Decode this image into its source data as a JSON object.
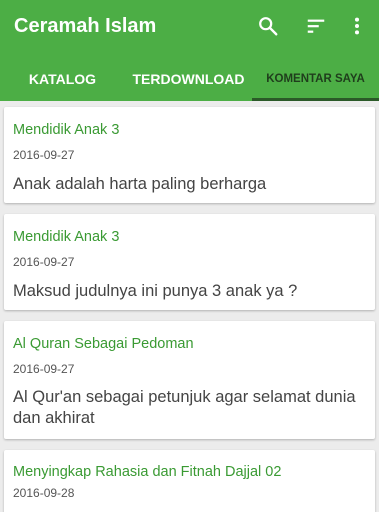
{
  "appbar": {
    "title": "Ceramah Islam",
    "accent_color": "#4cae45",
    "icons": [
      "search-icon",
      "sort-icon",
      "more-vert-icon"
    ]
  },
  "tabs": [
    {
      "label": "KATALOG",
      "selected": false
    },
    {
      "label": "TERDOWNLOAD",
      "selected": false
    },
    {
      "label": "KOMENTAR SAYA",
      "selected": true
    }
  ],
  "comments": [
    {
      "title": "Mendidik Anak 3",
      "date": "2016-09-27",
      "text": "Anak adalah harta paling berharga"
    },
    {
      "title": "Mendidik Anak 3",
      "date": "2016-09-27",
      "text": "Maksud judulnya ini punya 3 anak ya ?"
    },
    {
      "title": "Al Quran Sebagai Pedoman",
      "date": "2016-09-27",
      "text": "Al Qur'an sebagai petunjuk agar selamat dunia dan akhirat"
    },
    {
      "title": "Menyingkap Rahasia dan Fitnah Dajjal 02",
      "date": "2016-09-28",
      "text": ""
    }
  ]
}
